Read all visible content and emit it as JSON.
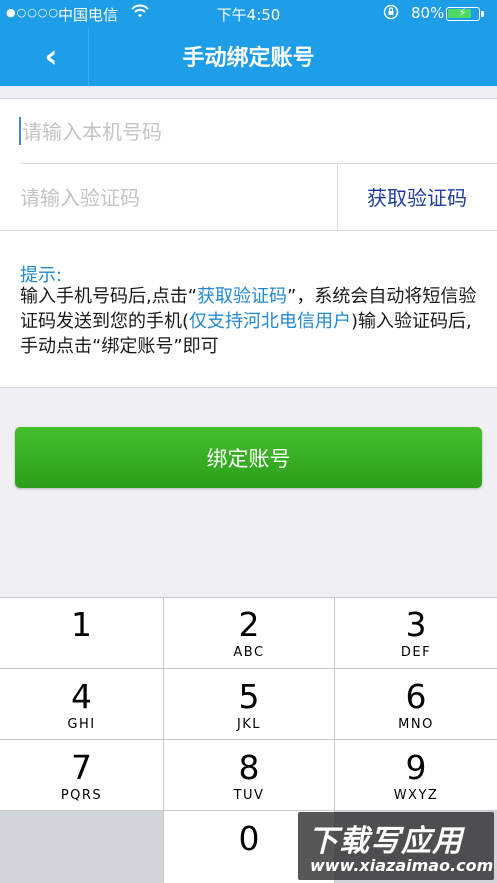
{
  "status_bar": {
    "signal_dots": "●○○○○",
    "carrier": "中国电信",
    "wifi_icon": "wifi-icon",
    "time": "下午4:50",
    "lock_icon": "orientation-lock-icon",
    "battery_percent": "80%",
    "battery_level": 0.8,
    "battery_color": "#4cd964"
  },
  "nav": {
    "back_icon": "chevron-left-icon",
    "back_glyph": "‹",
    "title": "手动绑定账号",
    "bg_color": "#1e9de8"
  },
  "form": {
    "phone_placeholder": "请输入本机号码",
    "phone_value": "",
    "code_placeholder": "请输入验证码",
    "code_value": "",
    "get_code_label": "获取验证码"
  },
  "tip": {
    "title": "提示:",
    "part1": " 输入手机号码后,点击“",
    "part2_highlight": "获取验证码",
    "part3": "”，系统会自动将短信验证码发送到您的手机(",
    "part4_highlight": "仅支持河北电信用户",
    "part5": ")输入验证码后,手动点击“绑定账号”即可"
  },
  "bind_button": {
    "label": "绑定账号",
    "color": "#35ad22"
  },
  "keypad": {
    "keys": [
      {
        "num": "1",
        "letters": ""
      },
      {
        "num": "2",
        "letters": "ABC"
      },
      {
        "num": "3",
        "letters": "DEF"
      },
      {
        "num": "4",
        "letters": "GHI"
      },
      {
        "num": "5",
        "letters": "JKL"
      },
      {
        "num": "6",
        "letters": "MNO"
      },
      {
        "num": "7",
        "letters": "PQRS"
      },
      {
        "num": "8",
        "letters": "TUV"
      },
      {
        "num": "9",
        "letters": "WXYZ"
      },
      {
        "num": "0",
        "letters": ""
      }
    ]
  },
  "watermark": {
    "line1": "下载写应用",
    "line2": "www.xiazaimao.com"
  }
}
